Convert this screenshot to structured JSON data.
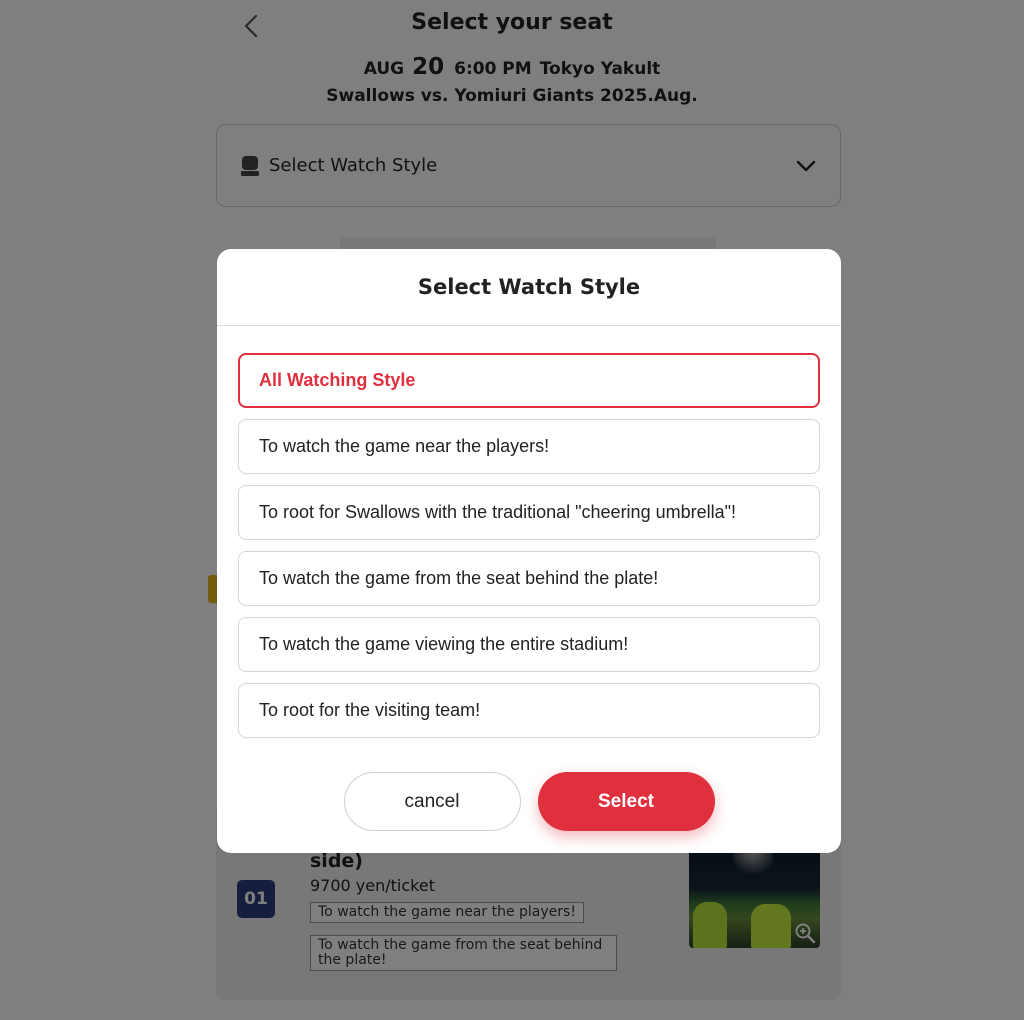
{
  "header": {
    "title": "Select your seat",
    "event": {
      "month": "AUG",
      "day": "20",
      "time": "6:00 PM",
      "line1_team": "Tokyo Yakult",
      "line2": "Swallows vs. Yomiuri Giants 2025.Aug."
    }
  },
  "watch_style_select": {
    "label": "Select Watch Style",
    "icon": "seat-icon"
  },
  "seat_card": {
    "name_tail": "side)",
    "number": "01",
    "price": "9700 yen/ticket",
    "tags": [
      "To watch the game near the players!",
      "To watch the game from the seat behind the plate!"
    ]
  },
  "modal": {
    "title": "Select Watch Style",
    "options": [
      "All Watching Style",
      "To watch the game near the players!",
      "To root for Swallows with the traditional \"cheering umbrella\"!",
      "To watch the game from the seat behind the plate!",
      "To watch the game viewing the entire stadium!",
      "To root for the visiting team!"
    ],
    "selected_index": 0,
    "cancel_label": "cancel",
    "select_label": "Select"
  },
  "colors": {
    "accent": "#e0303e",
    "seat_number_bg": "#2a3f7a",
    "overlay": "rgba(0,0,0,0.5)"
  }
}
